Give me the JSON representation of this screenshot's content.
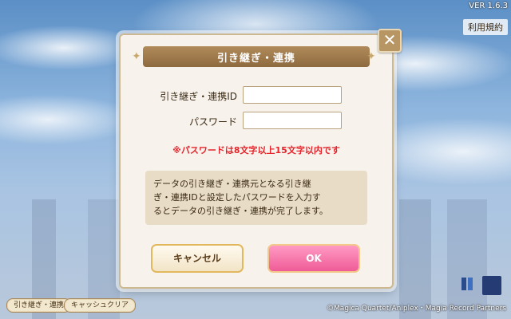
{
  "top": {
    "version": "VER 1.6.3",
    "terms_label": "利用規約"
  },
  "dialog": {
    "title": "引き継ぎ・連携",
    "fields": {
      "id_label": "引き継ぎ・連携ID",
      "id_value": "",
      "password_label": "パスワード",
      "password_value": ""
    },
    "warning": "※パスワードは8文字以上15文字以内です",
    "info_lines": [
      "データの引き継ぎ・連携元となる引き継",
      "ぎ・連携IDと設定したパスワードを入力す",
      "るとデータの引き継ぎ・連携が完了します。"
    ],
    "buttons": {
      "cancel": "キャンセル",
      "ok": "OK"
    }
  },
  "bottom": {
    "transfer_button": "引き継ぎ・連携",
    "cache_clear_button": "キャッシュクリア",
    "copyright": "©Magica Quartet/Aniplex・Magia Record Partners"
  },
  "colors": {
    "accent_brown": "#8e6b3f",
    "ok_pink": "#ef5c97",
    "warning_red": "#e5242b"
  }
}
